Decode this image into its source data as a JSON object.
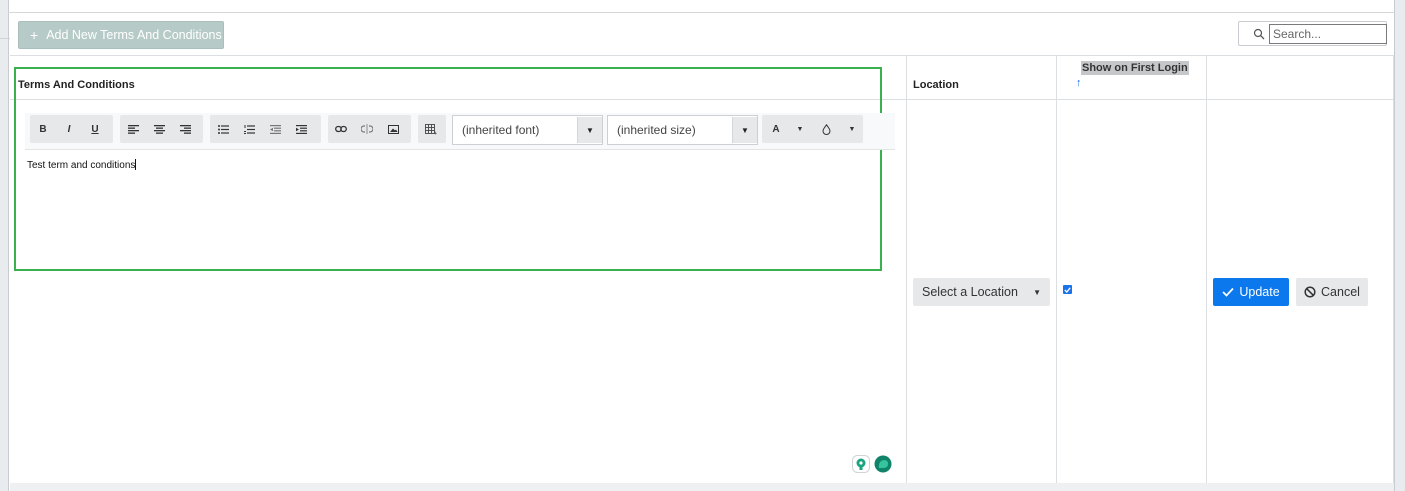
{
  "toolbar_top": {
    "add_button_label": "Add New Terms And Conditions",
    "search_placeholder": "Search..."
  },
  "table": {
    "headers": {
      "terms": "Terms And Conditions",
      "location": "Location",
      "show_first_login": "Show on First Login",
      "sort_indicator": "↑"
    }
  },
  "editor": {
    "font_select": "(inherited font)",
    "size_select": "(inherited size)",
    "color_label": "A",
    "content": "Test term and conditions",
    "buttons": [
      "bold",
      "italic",
      "underline",
      "align-left",
      "align-center",
      "align-right",
      "bullet-list",
      "numbered-list",
      "outdent",
      "indent",
      "link",
      "unlink",
      "image",
      "table",
      "font-color",
      "highlight-color"
    ]
  },
  "row": {
    "location_select": "Select a Location",
    "show_first_login_checked": true,
    "update_label": "Update",
    "cancel_label": "Cancel"
  },
  "colors": {
    "focus_border": "#3ab04f",
    "primary": "#0b78ed",
    "add_button": "#b6cbc7"
  }
}
